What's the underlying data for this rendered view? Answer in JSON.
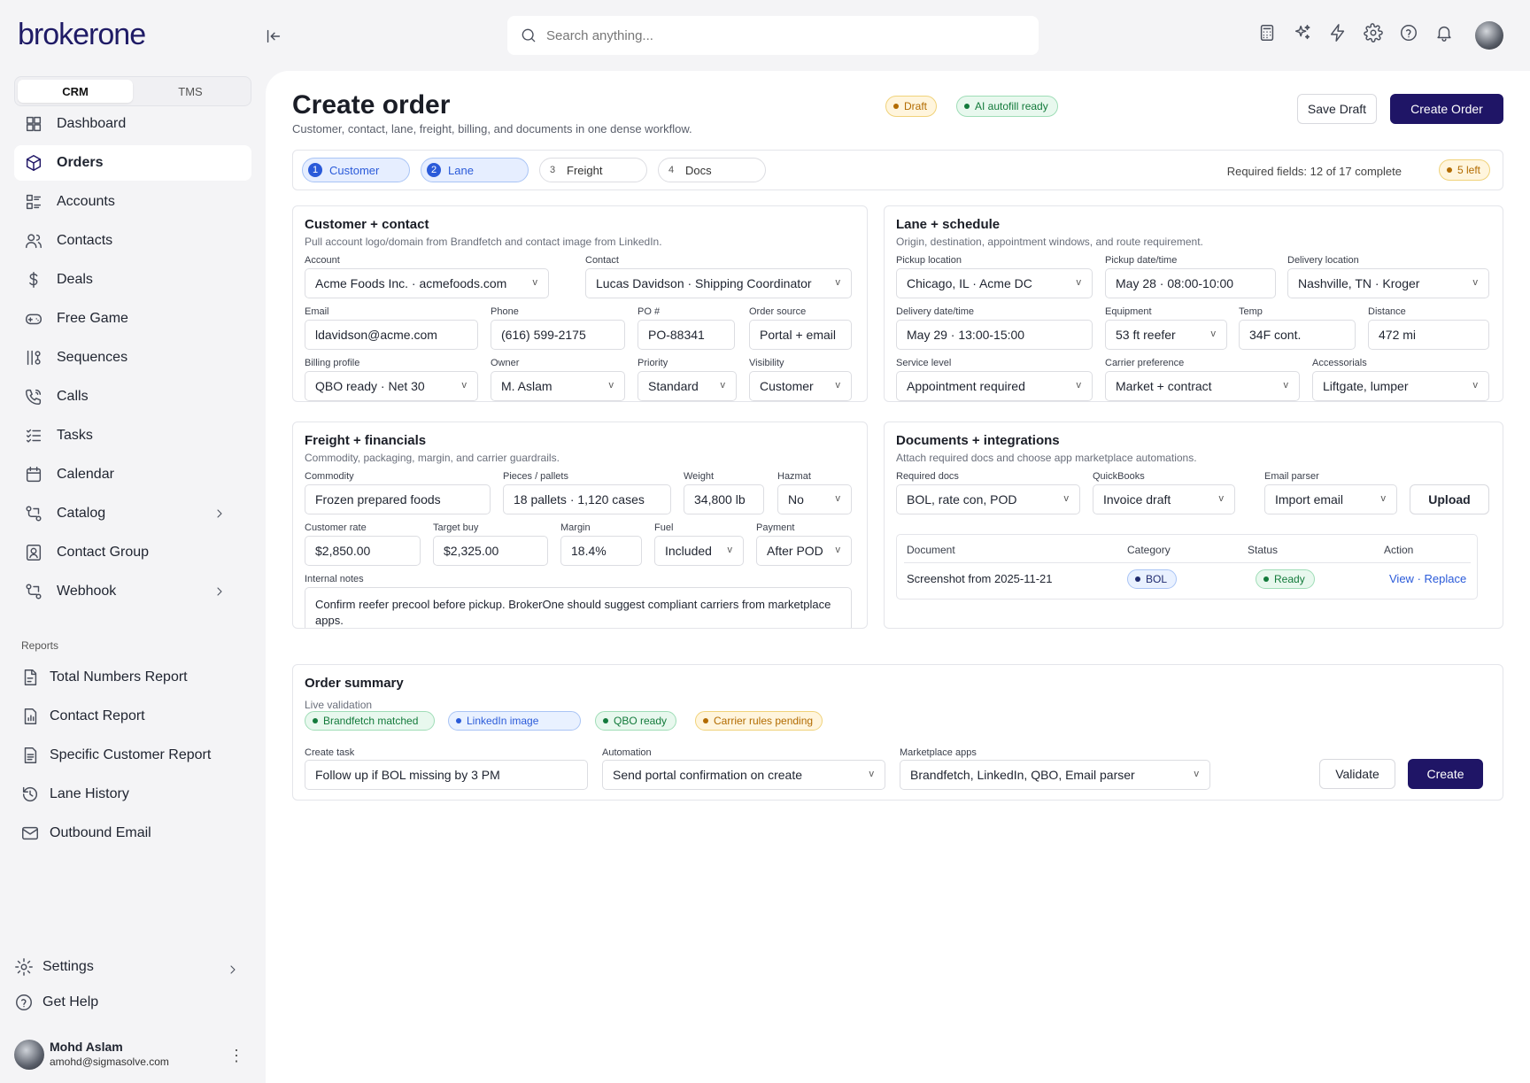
{
  "app": {
    "logo": "brokerone",
    "search_placeholder": "Search anything..."
  },
  "sidebar": {
    "tabs": [
      "CRM",
      "TMS"
    ],
    "items": [
      {
        "label": "Dashboard",
        "icon": "dashboard-icon"
      },
      {
        "label": "Orders",
        "icon": "box-icon",
        "active": true
      },
      {
        "label": "Accounts",
        "icon": "accounts-icon"
      },
      {
        "label": "Contacts",
        "icon": "contacts-icon"
      },
      {
        "label": "Deals",
        "icon": "dollar-icon"
      },
      {
        "label": "Free Game",
        "icon": "gamepad-icon"
      },
      {
        "label": "Sequences",
        "icon": "sequences-icon"
      },
      {
        "label": "Calls",
        "icon": "phone-icon"
      },
      {
        "label": "Tasks",
        "icon": "tasks-icon"
      },
      {
        "label": "Calendar",
        "icon": "calendar-icon"
      },
      {
        "label": "Catalog",
        "icon": "catalog-icon"
      },
      {
        "label": "Contact Group",
        "icon": "contact-group-icon"
      },
      {
        "label": "Webhook",
        "icon": "webhook-icon"
      }
    ],
    "reports_heading": "Reports",
    "reports": [
      "Total Numbers Report",
      "Contact Report",
      "Specific Customer Report",
      "Lane History",
      "Outbound Email"
    ],
    "settings": "Settings",
    "help": "Get Help",
    "user": {
      "name": "Mohd Aslam",
      "email": "amohd@sigmasolve.com"
    }
  },
  "page": {
    "title": "Create order",
    "subtitle": "Customer, contact, lane, freight, billing, and documents in one dense workflow.",
    "badges": {
      "draft": "Draft",
      "ai": "AI autofill ready"
    },
    "save_draft": "Save Draft",
    "create_order": "Create Order"
  },
  "steps": {
    "items": [
      {
        "n": "1",
        "label": "Customer"
      },
      {
        "n": "2",
        "label": "Lane"
      },
      {
        "n": "3",
        "label": "Freight"
      },
      {
        "n": "4",
        "label": "Docs"
      }
    ],
    "required": "Required fields: 12 of 17 complete",
    "left": "5 left"
  },
  "customer": {
    "title": "Customer + contact",
    "sub": "Pull account logo/domain from Brandfetch and contact image from LinkedIn.",
    "account_l": "Account",
    "account": "Acme Foods Inc. · acmefoods.com",
    "contact_l": "Contact",
    "contact": "Lucas Davidson · Shipping Coordinator",
    "email_l": "Email",
    "email": "ldavidson@acme.com",
    "phone_l": "Phone",
    "phone": "(616) 599-2175",
    "po_l": "PO #",
    "po": "PO-88341",
    "source_l": "Order source",
    "source": "Portal + email",
    "billing_l": "Billing profile",
    "billing": "QBO ready · Net 30",
    "owner_l": "Owner",
    "owner": "M. Aslam",
    "priority_l": "Priority",
    "priority": "Standard",
    "visibility_l": "Visibility",
    "visibility": "Customer"
  },
  "lane": {
    "title": "Lane + schedule",
    "sub": "Origin, destination, appointment windows, and route requirement.",
    "pickup_l": "Pickup location",
    "pickup": "Chicago, IL · Acme DC",
    "pdate_l": "Pickup date/time",
    "pdate": "May 28 · 08:00-10:00",
    "delivery_l": "Delivery location",
    "delivery": "Nashville, TN · Kroger",
    "ddate_l": "Delivery date/time",
    "ddate": "May 29 · 13:00-15:00",
    "equip_l": "Equipment",
    "equip": "53 ft reefer",
    "temp_l": "Temp",
    "temp": "34F cont.",
    "dist_l": "Distance",
    "dist": "472 mi",
    "service_l": "Service level",
    "service": "Appointment required",
    "carrier_l": "Carrier preference",
    "carrier": "Market + contract",
    "acc_l": "Accessorials",
    "acc": "Liftgate, lumper"
  },
  "freight": {
    "title": "Freight + financials",
    "sub": "Commodity, packaging, margin, and carrier guardrails.",
    "commodity_l": "Commodity",
    "commodity": "Frozen prepared foods",
    "pieces_l": "Pieces / pallets",
    "pieces": "18 pallets · 1,120 cases",
    "weight_l": "Weight",
    "weight": "34,800 lb",
    "hazmat_l": "Hazmat",
    "hazmat": "No",
    "rate_l": "Customer rate",
    "rate": "$2,850.00",
    "buy_l": "Target buy",
    "buy": "$2,325.00",
    "margin_l": "Margin",
    "margin": "18.4%",
    "fuel_l": "Fuel",
    "fuel": "Included",
    "payment_l": "Payment",
    "payment": "After POD",
    "notes_l": "Internal notes",
    "notes": "Confirm reefer precool before pickup. BrokerOne should suggest compliant carriers from marketplace apps."
  },
  "docs": {
    "title": "Documents + integrations",
    "sub": "Attach required docs and choose app marketplace automations.",
    "req_l": "Required docs",
    "req": "BOL, rate con, POD",
    "qb_l": "QuickBooks",
    "qb": "Invoice draft",
    "parser_l": "Email parser",
    "parser": "Import email",
    "upload": "Upload",
    "cols": [
      "Document",
      "Category",
      "Status",
      "Action"
    ],
    "row": {
      "document": "Screenshot from 2025-11-21",
      "category": "BOL",
      "status": "Ready",
      "view": "View",
      "sep": " · ",
      "replace": "Replace"
    }
  },
  "summary": {
    "title": "Order summary",
    "sub": "Live validation",
    "tags": [
      "Brandfetch matched",
      "LinkedIn image",
      "QBO ready",
      "Carrier rules pending"
    ],
    "task_l": "Create task",
    "task": "Follow up if BOL missing by 3 PM",
    "auto_l": "Automation",
    "auto": "Send portal confirmation on create",
    "apps_l": "Marketplace apps",
    "apps": "Brandfetch, LinkedIn, QBO, Email parser",
    "validate": "Validate",
    "create": "Create"
  },
  "colors": {
    "primary": "#1f1566",
    "accent_blue": "#2a5ad9",
    "green": "#137a3b",
    "amber": "#b26b00"
  }
}
